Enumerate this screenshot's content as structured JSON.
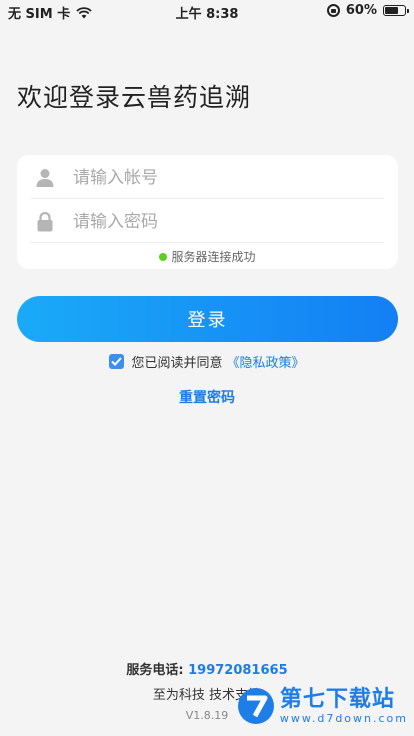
{
  "status_bar": {
    "carrier": "无 SIM 卡",
    "time": "上午 8:38",
    "battery": "60%",
    "battery_level": 0.6
  },
  "welcome_title": "欢迎登录云兽药追溯",
  "form": {
    "account_placeholder": "请输入帐号",
    "password_placeholder": "请输入密码",
    "connection_status": "服务器连接成功",
    "connection_color": "#5fd01b"
  },
  "login_button": "登录",
  "agreement": {
    "checked": true,
    "text": "您已阅读并同意",
    "policy_link": "《隐私政策》"
  },
  "reset_password": "重置密码",
  "footer": {
    "service_label": "服务电话:",
    "service_phone": "19972081665",
    "company": "至为科技 技术支持",
    "version": "V1.8.19"
  },
  "watermark": {
    "title": "第七下载站",
    "url": "www.d7down.com"
  },
  "colors": {
    "accent": "#1b7de8",
    "button_start": "#1aaaf8",
    "button_end": "#137ff4",
    "background": "#f4f4f4"
  }
}
